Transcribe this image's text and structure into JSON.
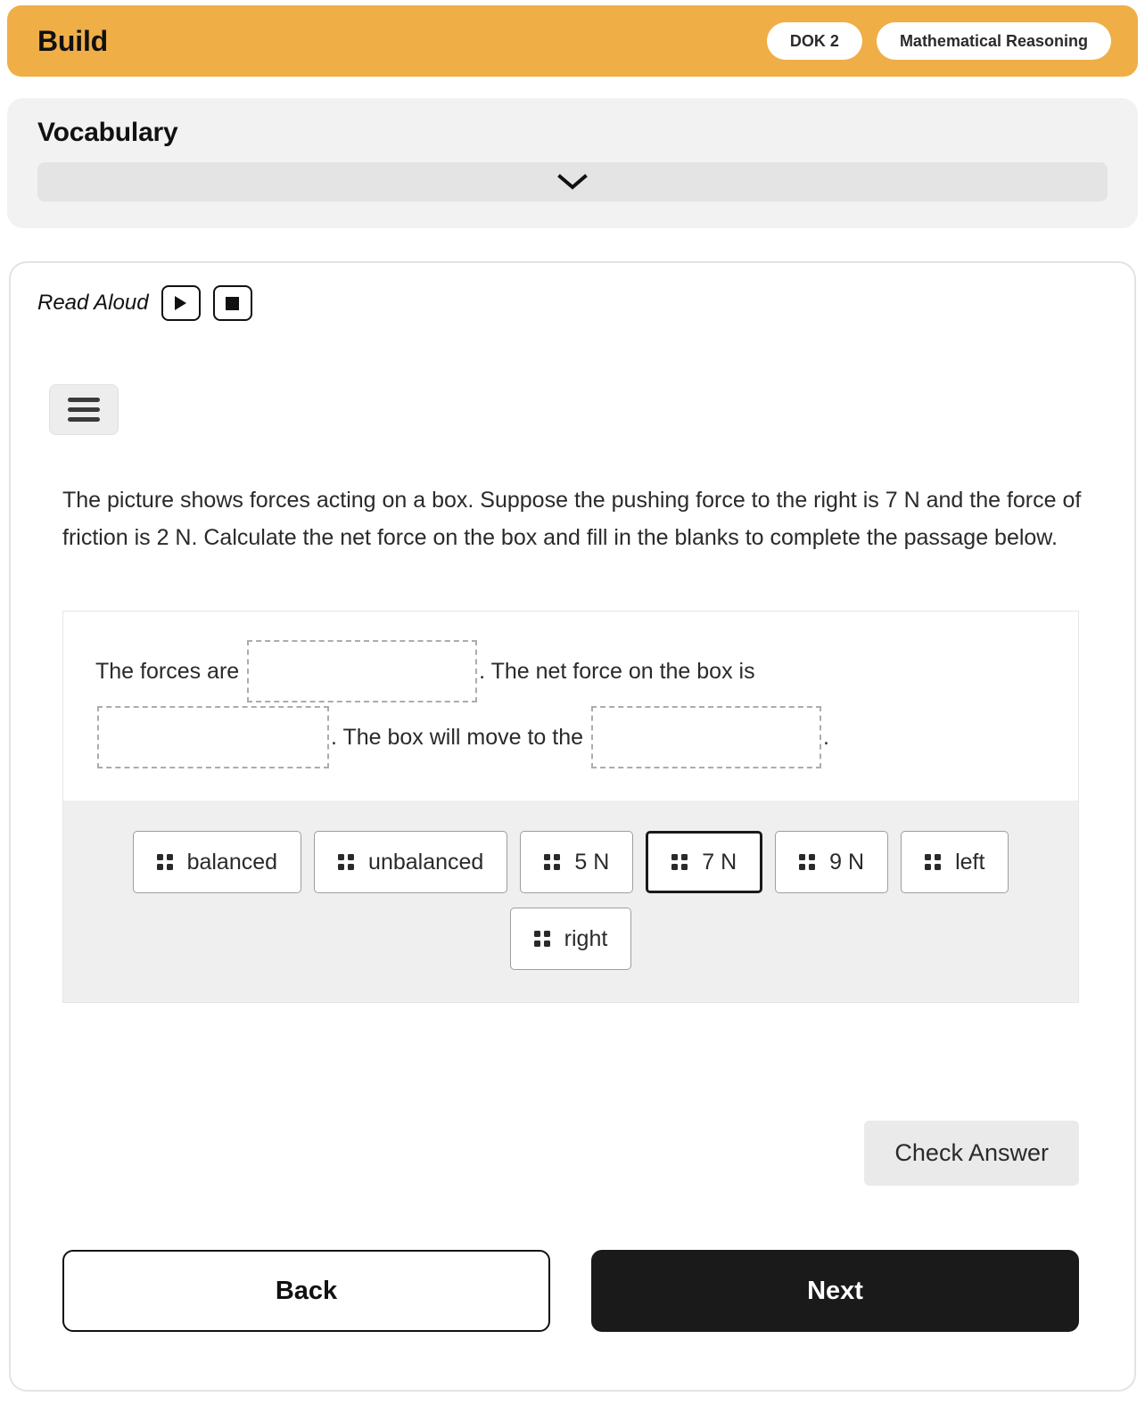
{
  "header": {
    "title": "Build",
    "badges": [
      {
        "label": "DOK 2",
        "name": "dok-badge"
      },
      {
        "label": "Mathematical Reasoning",
        "name": "standard-badge"
      }
    ],
    "accent_color": "#F0AE47"
  },
  "vocabulary": {
    "title": "Vocabulary",
    "select_value": "",
    "chevron_icon": "chevron-down-icon"
  },
  "read_aloud": {
    "label": "Read Aloud",
    "play_icon": "play-icon",
    "stop_icon": "stop-icon"
  },
  "menu": {
    "icon": "hamburger-menu-icon"
  },
  "question": {
    "prompt": "The picture shows forces acting on a box. Suppose the pushing force to the right is 7 N and the force of friction is 2 N. Calculate the net force on the box and fill in the blanks to complete the passage below."
  },
  "cloze": {
    "segment_1": "The forces are ",
    "blank_1_value": "",
    "segment_2": ". The net force on the box is",
    "blank_2_value": "",
    "segment_3": ". The box will move to the ",
    "blank_3_value": "",
    "segment_4": ".",
    "blank_border_color": "#ACACAC"
  },
  "tray": {
    "background_color": "#EFEFEF",
    "row_1": [
      {
        "label": "balanced",
        "selected": false
      },
      {
        "label": "unbalanced",
        "selected": false
      },
      {
        "label": "5 N",
        "selected": false
      },
      {
        "label": "7 N",
        "selected": true
      },
      {
        "label": "9 N",
        "selected": false
      },
      {
        "label": "left",
        "selected": false
      }
    ],
    "row_2": [
      {
        "label": "right",
        "selected": false
      }
    ],
    "drag_handle_icon": "drag-handle-icon"
  },
  "actions": {
    "check_answer_label": "Check Answer",
    "back_label": "Back",
    "next_label": "Next"
  }
}
